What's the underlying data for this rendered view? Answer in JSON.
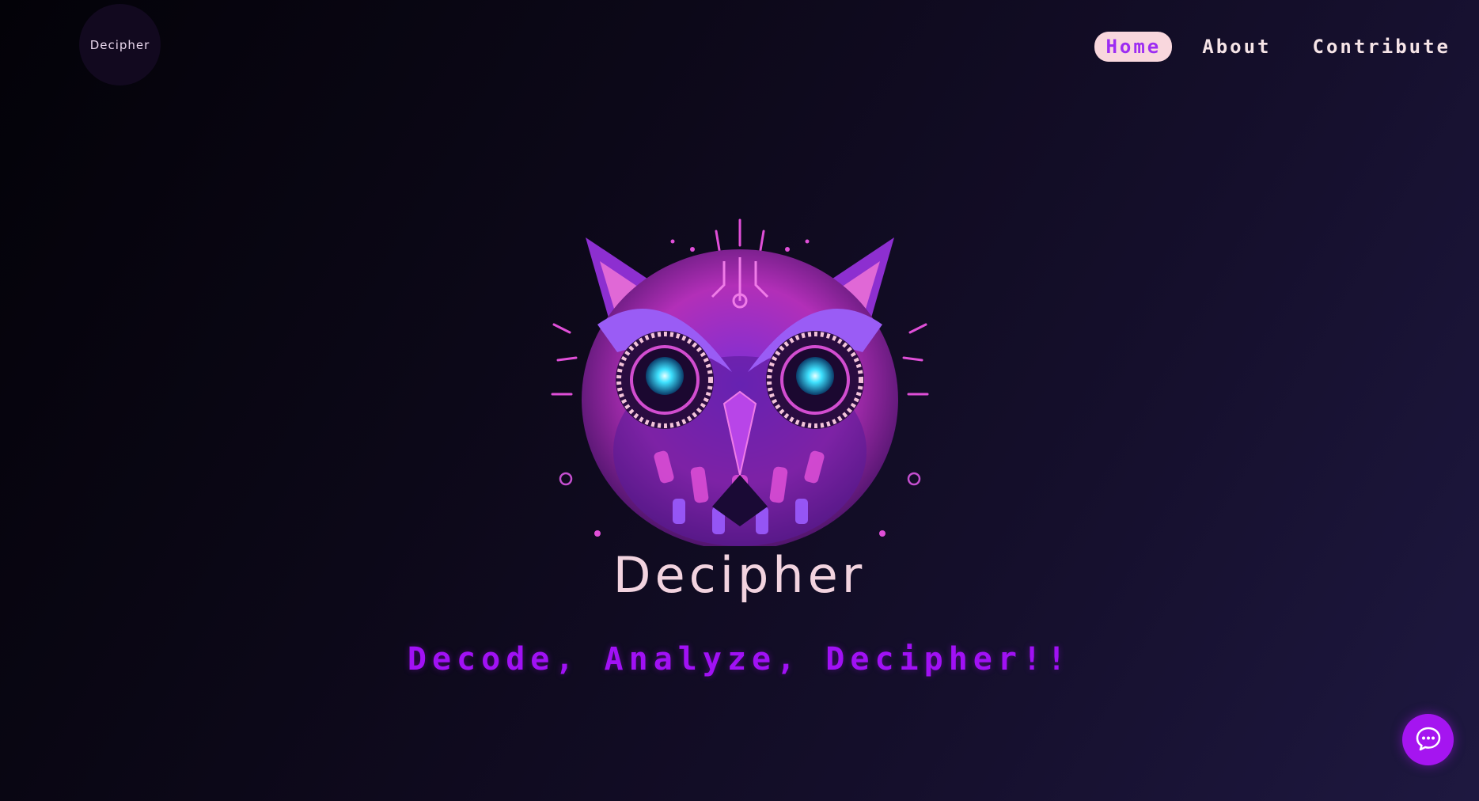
{
  "logo": {
    "label": "Decipher"
  },
  "nav": {
    "items": [
      {
        "label": "Home",
        "active": true
      },
      {
        "label": "About",
        "active": false
      },
      {
        "label": "Contribute",
        "active": false
      }
    ]
  },
  "hero": {
    "icon": "owl-logo-icon",
    "brand_text": "Decipher",
    "tagline": "Decode, Analyze, Decipher!!"
  },
  "chat": {
    "icon": "chat-bubble-icon"
  },
  "colors": {
    "accent": "#a111f5",
    "nav_active_bg": "#f9d7dd",
    "nav_active_text": "#9d2cf2",
    "nav_text": "#f6e4e7",
    "brand_text": "#f2d3df",
    "owl_eye": "#3fe2ff"
  }
}
